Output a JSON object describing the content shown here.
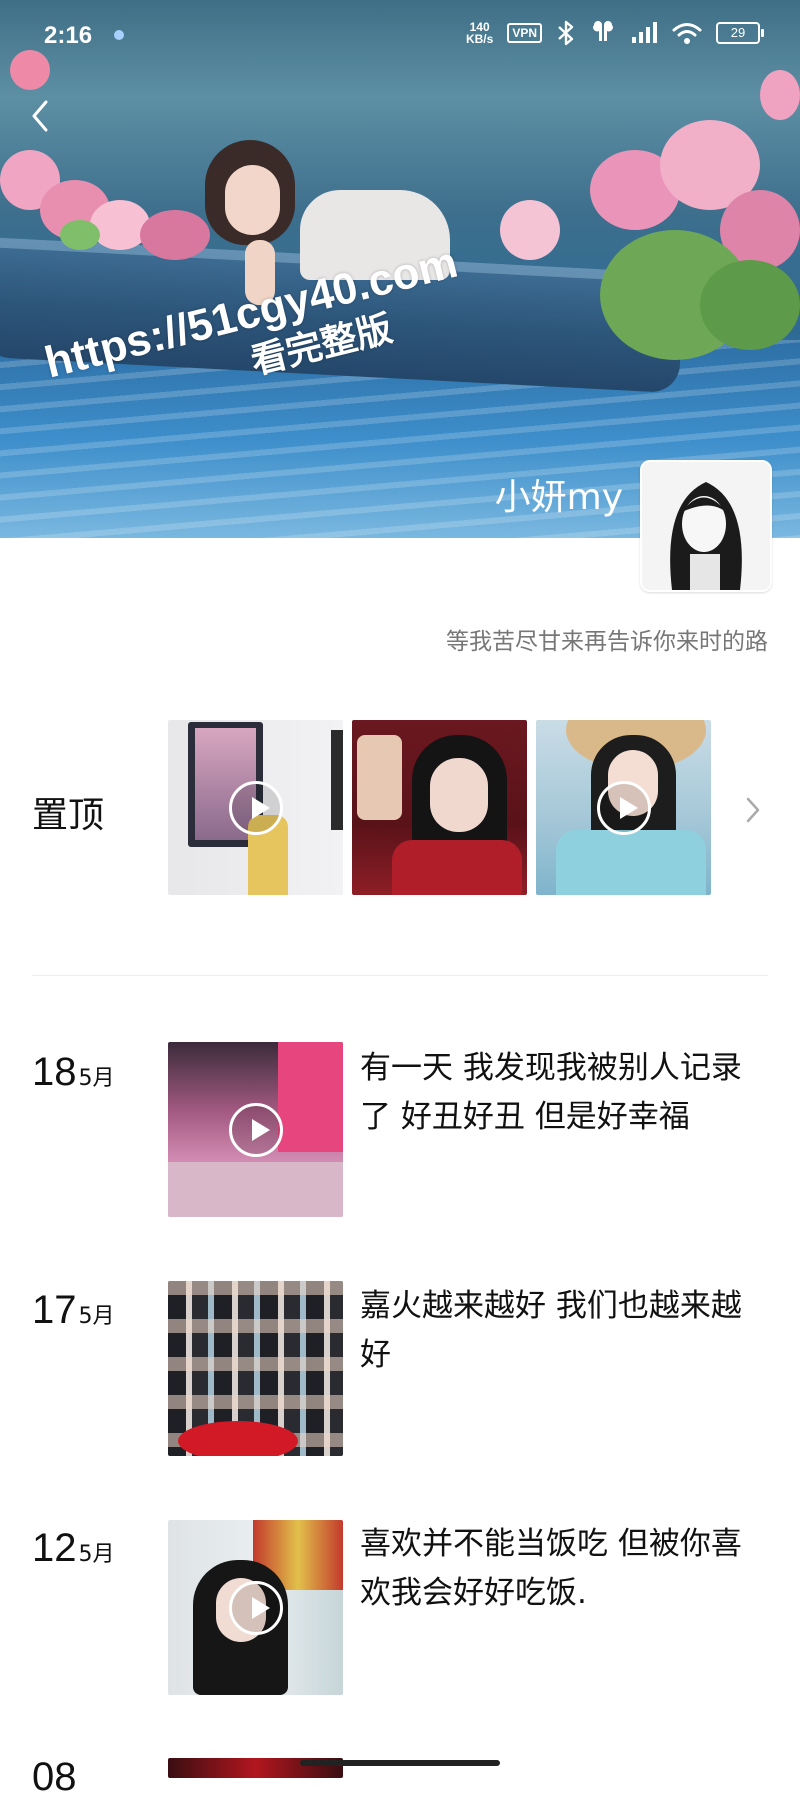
{
  "status_bar": {
    "time": "2:16",
    "net_speed_value": "140",
    "net_speed_unit": "KB/s",
    "vpn": "VPN",
    "battery": "29"
  },
  "header": {
    "watermark_url": "https://51cgy40.com",
    "watermark_sub": "看完整版",
    "username": "小妍my",
    "signature": "等我苦尽甘来再告诉你来时的路"
  },
  "pinned": {
    "label": "置顶",
    "items": [
      {
        "type": "video"
      },
      {
        "type": "photo"
      },
      {
        "type": "video"
      }
    ]
  },
  "posts": [
    {
      "day": "18",
      "month": "5月",
      "text": "有一天 我发现我被别人记录了 好丑好丑 但是好幸福",
      "type": "video"
    },
    {
      "day": "17",
      "month": "5月",
      "text": "嘉火越来越好 我们也越来越好",
      "type": "photo"
    },
    {
      "day": "12",
      "month": "5月",
      "text": "喜欢并不能当饭吃 但被你喜欢我会好好吃饭.",
      "type": "video"
    },
    {
      "day": "08",
      "month": "",
      "text": "",
      "type": "photo"
    }
  ],
  "icons": {
    "back": "chevron-left-icon",
    "more": "chevron-right-icon",
    "play": "play-icon"
  }
}
